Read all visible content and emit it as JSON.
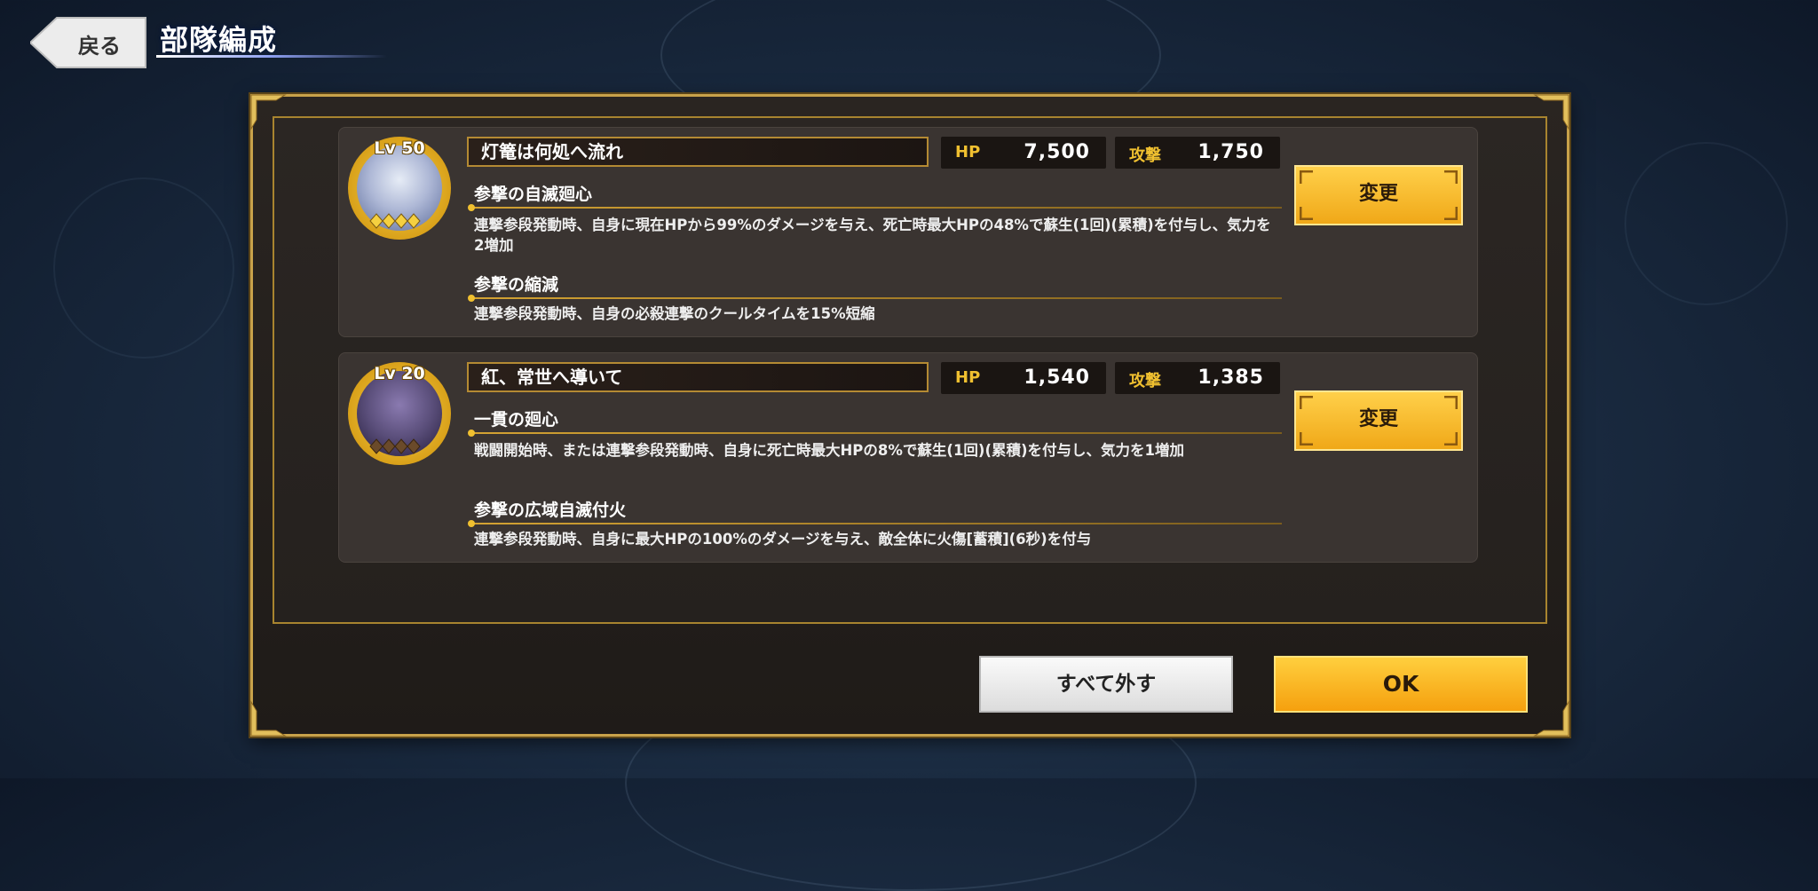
{
  "header": {
    "back_label": "戻る",
    "title": "部隊編成"
  },
  "units": [
    {
      "level": "Lv 50",
      "name": "灯篭は何処へ流れ",
      "hp_label": "HP",
      "hp": "7,500",
      "atk_label": "攻撃",
      "atk": "1,750",
      "change_label": "変更",
      "skills": [
        {
          "title": "参撃の自滅廻心",
          "desc": "連撃参段発動時、自身に現在HPから99%のダメージを与え、死亡時最大HPの48%で蘇生(1回)(累積)を付与し、気力を2増加"
        },
        {
          "title": "参撃の縮減",
          "desc": "連撃参段発動時、自身の必殺連撃のクールタイムを15%短縮"
        }
      ],
      "avatar_color": "#aeb8d6"
    },
    {
      "level": "Lv 20",
      "name": "紅、常世へ導いて",
      "hp_label": "HP",
      "hp": "1,540",
      "atk_label": "攻撃",
      "atk": "1,385",
      "change_label": "変更",
      "skills": [
        {
          "title": "一貫の廻心",
          "desc": "戦闘開始時、または連撃参段発動時、自身に死亡時最大HPの8%で蘇生(1回)(累積)を付与し、気力を1増加"
        },
        {
          "title": "参撃の広域自滅付火",
          "desc": "連撃参段発動時、自身に最大HPの100%のダメージを与え、敵全体に火傷[蓄積](6秒)を付与"
        }
      ],
      "avatar_color": "#5a4e7a"
    }
  ],
  "footer": {
    "remove_all_label": "すべて外す",
    "ok_label": "OK"
  }
}
